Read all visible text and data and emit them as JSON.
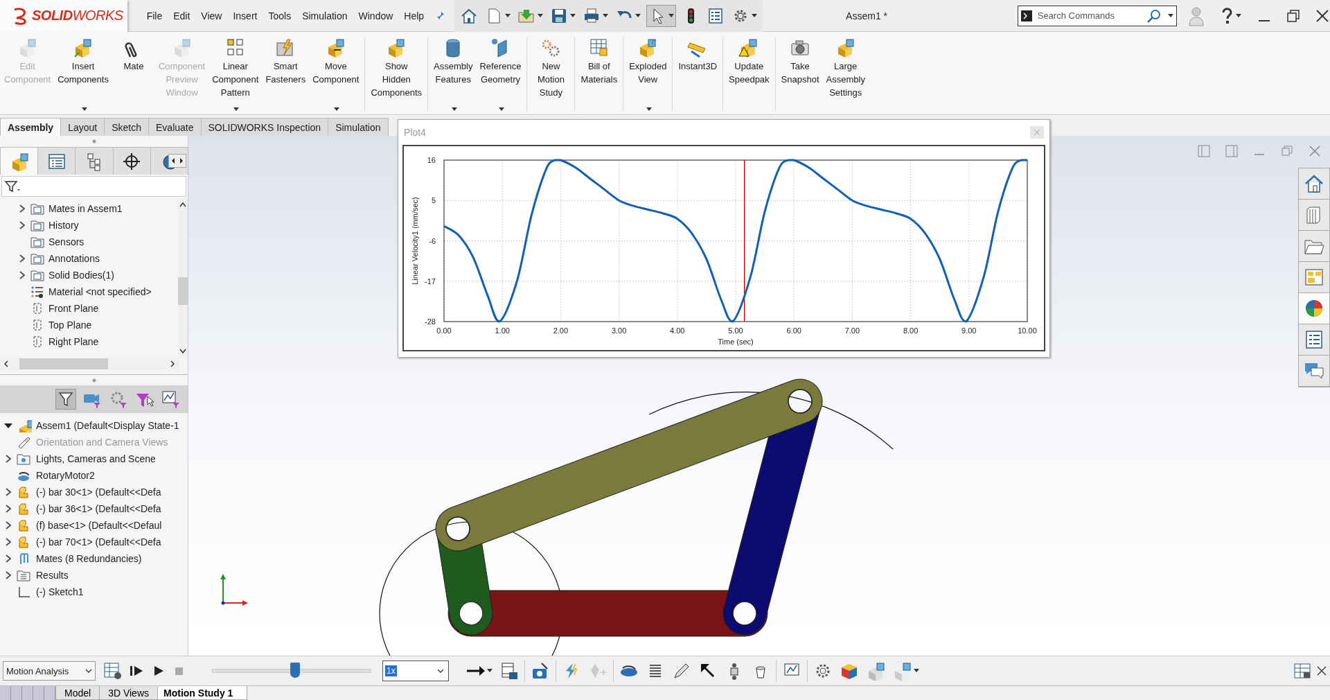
{
  "app": {
    "logo": "**SOLID**WORKS",
    "document_title": "Assem1 *"
  },
  "menu": [
    "File",
    "Edit",
    "View",
    "Insert",
    "Tools",
    "Simulation",
    "Window",
    "Help"
  ],
  "search": {
    "placeholder": "Search Commands"
  },
  "ribbon_groups": [
    {
      "buttons": [
        {
          "label": "Edit Component",
          "disabled": true,
          "dropdown": false
        },
        {
          "label": "Insert Components",
          "disabled": false,
          "dropdown": true
        },
        {
          "label": "Mate",
          "disabled": false,
          "dropdown": false
        },
        {
          "label": "Component Preview Window",
          "disabled": true,
          "dropdown": false
        },
        {
          "label": "Linear Component Pattern",
          "disabled": false,
          "dropdown": true
        },
        {
          "label": "Smart Fasteners",
          "disabled": false,
          "dropdown": false
        },
        {
          "label": "Move Component",
          "disabled": false,
          "dropdown": true
        }
      ]
    },
    {
      "buttons": [
        {
          "label": "Show Hidden Components",
          "disabled": false,
          "dropdown": false
        }
      ]
    },
    {
      "buttons": [
        {
          "label": "Assembly Features",
          "disabled": false,
          "dropdown": true
        },
        {
          "label": "Reference Geometry",
          "disabled": false,
          "dropdown": true
        }
      ]
    },
    {
      "buttons": [
        {
          "label": "New Motion Study",
          "disabled": false,
          "dropdown": false
        }
      ]
    },
    {
      "buttons": [
        {
          "label": "Bill of Materials",
          "disabled": false,
          "dropdown": false
        }
      ]
    },
    {
      "buttons": [
        {
          "label": "Exploded View",
          "disabled": false,
          "dropdown": true
        }
      ]
    },
    {
      "buttons": [
        {
          "label": "Instant3D",
          "disabled": false,
          "dropdown": false
        }
      ]
    },
    {
      "buttons": [
        {
          "label": "Update Speedpak",
          "disabled": false,
          "dropdown": false
        }
      ]
    },
    {
      "buttons": [
        {
          "label": "Take Snapshot",
          "disabled": false,
          "dropdown": false
        },
        {
          "label": "Large Assembly Settings",
          "disabled": false,
          "dropdown": false
        }
      ]
    }
  ],
  "command_tabs": [
    {
      "label": "Assembly",
      "selected": true
    },
    {
      "label": "Layout",
      "selected": false
    },
    {
      "label": "Sketch",
      "selected": false
    },
    {
      "label": "Evaluate",
      "selected": false
    },
    {
      "label": "SOLIDWORKS Inspection",
      "selected": false
    },
    {
      "label": "Simulation",
      "selected": false
    }
  ],
  "manager_tabs": [
    {
      "selected": true
    },
    {
      "selected": false
    },
    {
      "selected": false
    },
    {
      "selected": false
    },
    {
      "selected": false
    }
  ],
  "feature_tree": {
    "items": [
      {
        "text": "Mates in Assem1",
        "expandable": true,
        "expanded": false
      },
      {
        "text": "History",
        "expandable": true,
        "expanded": false
      },
      {
        "text": "Sensors",
        "expandable": false
      },
      {
        "text": "Annotations",
        "expandable": true,
        "expanded": false
      },
      {
        "text": "Solid Bodies(1)",
        "expandable": true,
        "expanded": false
      },
      {
        "text": "Material <not specified>",
        "expandable": false
      },
      {
        "text": "Front Plane",
        "expandable": false
      },
      {
        "text": "Top Plane",
        "expandable": false
      },
      {
        "text": "Right Plane",
        "expandable": false
      }
    ]
  },
  "motion_tree": {
    "items": [
      {
        "text": "Assem1  (Default<Display State-1",
        "expandable": true,
        "expanded": true,
        "disabled": false
      },
      {
        "text": "Orientation and Camera Views",
        "expandable": false,
        "disabled": true
      },
      {
        "text": "Lights, Cameras and Scene",
        "expandable": true,
        "expanded": false,
        "disabled": false
      },
      {
        "text": "RotaryMotor2",
        "expandable": false,
        "disabled": false
      },
      {
        "text": "(-) bar 30<1> (Default<<Defa",
        "expandable": true,
        "expanded": false,
        "disabled": false
      },
      {
        "text": "(-) bar 36<1> (Default<<Defa",
        "expandable": true,
        "expanded": false,
        "disabled": false
      },
      {
        "text": "(f) base<1> (Default<<Defaul",
        "expandable": true,
        "expanded": false,
        "disabled": false
      },
      {
        "text": "(-) bar 70<1> (Default<<Defa",
        "expandable": true,
        "expanded": false,
        "disabled": false
      },
      {
        "text": "Mates (8 Redundancies)",
        "expandable": true,
        "expanded": false,
        "disabled": false
      },
      {
        "text": "Results",
        "expandable": true,
        "expanded": false,
        "disabled": false
      },
      {
        "text": "(-) Sketch1",
        "expandable": false,
        "disabled": false
      }
    ]
  },
  "plot_window": {
    "title": "Plot4",
    "chart_data": {
      "type": "line",
      "xlabel": "Time (sec)",
      "ylabel": "Linear Velocity1 (mm/sec)",
      "x": [
        0,
        0.25,
        0.5,
        0.75,
        0.95,
        1.25,
        1.5,
        1.75,
        1.9,
        2.0,
        2.25,
        2.5,
        2.75,
        3.0,
        3.25,
        3.5,
        3.75,
        4.0,
        4.25,
        4.5,
        4.75,
        4.95,
        5.25,
        5.5,
        5.75,
        5.9,
        6.0,
        6.25,
        6.5,
        6.75,
        7.0,
        7.25,
        7.5,
        7.75,
        8.0,
        8.25,
        8.5,
        8.75,
        8.95,
        9.25,
        9.5,
        9.75,
        9.9,
        10.0
      ],
      "series": [
        {
          "color": "#0f5fb5",
          "values": [
            -2,
            -4.5,
            -10.5,
            -21,
            -28,
            -17,
            1,
            13.5,
            16,
            16,
            14,
            11,
            8,
            5,
            3.5,
            2.5,
            1.5,
            0,
            -4,
            -11,
            -22,
            -28,
            -16,
            2,
            14,
            16,
            16,
            14,
            11,
            8,
            5,
            3.5,
            2.5,
            1.5,
            0,
            -4,
            -11,
            -22,
            -28,
            -16,
            2,
            14,
            16,
            16
          ]
        }
      ],
      "xlim": [
        0,
        10
      ],
      "ylim": [
        -28,
        16
      ],
      "xticks": [
        {
          "value": 0,
          "label": "0.00"
        },
        {
          "value": 1,
          "label": "1.00"
        },
        {
          "value": 2,
          "label": "2.00"
        },
        {
          "value": 3,
          "label": "3.00"
        },
        {
          "value": 4,
          "label": "4.00"
        },
        {
          "value": 5,
          "label": "5.00"
        },
        {
          "value": 6,
          "label": "6.00"
        },
        {
          "value": 7,
          "label": "7.00"
        },
        {
          "value": 8,
          "label": "8.00"
        },
        {
          "value": 9,
          "label": "9.00"
        },
        {
          "value": 10,
          "label": "10.00"
        }
      ],
      "yticks": [
        -28,
        -17,
        -6,
        5,
        16
      ],
      "grid": true,
      "ref_lines": [
        {
          "axis": "x",
          "value": 5.15
        }
      ]
    }
  },
  "motion_manager": {
    "study_type": "Motion Analysis",
    "timeline": {
      "level": 0.52
    },
    "playback_speed": "1x",
    "tabs": [
      {
        "label": "Model",
        "selected": false
      },
      {
        "label": "3D Views",
        "selected": false
      },
      {
        "label": "Motion Study 1",
        "selected": true
      }
    ]
  }
}
